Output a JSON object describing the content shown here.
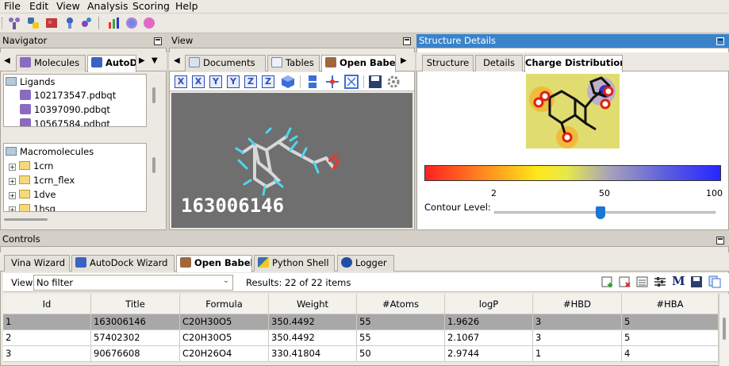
{
  "menu": [
    "File",
    "Edit",
    "View",
    "Analysis",
    "Scoring",
    "Help"
  ],
  "navigator": {
    "title": "Navigator",
    "tabs": [
      "Molecules",
      "AutoD"
    ],
    "ligands_label": "Ligands",
    "ligands": [
      "102173547.pdbqt",
      "10397090.pdbqt",
      "10567584.pdbqt"
    ],
    "macromolecules_label": "Macromolecules",
    "macromolecules": [
      "1crn",
      "1crn_flex",
      "1dve",
      "1hsg"
    ]
  },
  "view": {
    "title": "View",
    "tabs": [
      "Documents",
      "Tables",
      "Open Babel"
    ],
    "tool_letters": [
      "X",
      "X",
      "Y",
      "Y",
      "Z",
      "Z"
    ],
    "molecule_id": "163006146"
  },
  "structure": {
    "title": "Structure Details",
    "tabs": [
      "Structure",
      "Details",
      "Charge Distribution"
    ],
    "scale_ticks": [
      "2",
      "50",
      "100"
    ],
    "contour_label": "Contour Level:",
    "contour_level": 0.48
  },
  "controls": {
    "title": "Controls",
    "tabs": [
      "Vina Wizard",
      "AutoDock Wizard",
      "Open Babel",
      "Python Shell",
      "Logger"
    ],
    "view_label": "View:",
    "filter_value": "No filter",
    "results_text": "Results: 22 of 22 items",
    "table": {
      "columns": [
        "Id",
        "Title",
        "Formula",
        "Weight",
        "#Atoms",
        "logP",
        "#HBD",
        "#HBA"
      ],
      "rows": [
        [
          "1",
          "163006146",
          "C20H30O5",
          "350.4492",
          "55",
          "1.9626",
          "3",
          "5"
        ],
        [
          "2",
          "57402302",
          "C20H30O5",
          "350.4492",
          "55",
          "2.1067",
          "3",
          "5"
        ],
        [
          "3",
          "90676608",
          "C20H26O4",
          "330.41804",
          "50",
          "2.9744",
          "1",
          "4"
        ]
      ]
    }
  }
}
